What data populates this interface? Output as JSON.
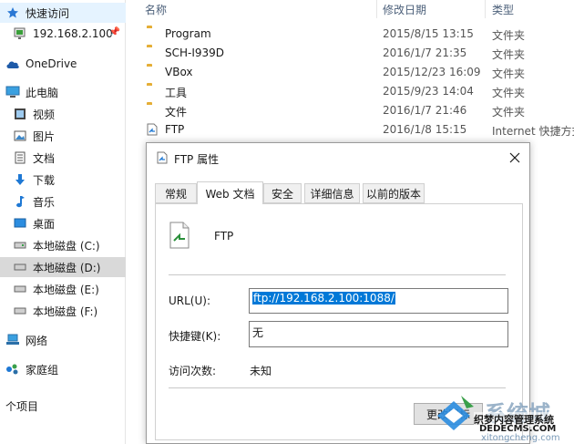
{
  "nav": {
    "items": [
      {
        "label": "快速访问",
        "icon": "star-icon"
      },
      {
        "label": "192.168.2.100",
        "icon": "network-location-icon",
        "pinned": true
      },
      {
        "label": "OneDrive",
        "icon": "cloud-icon"
      },
      {
        "label": "此电脑",
        "icon": "computer-icon"
      },
      {
        "label": "视频",
        "icon": "video-icon"
      },
      {
        "label": "图片",
        "icon": "pictures-icon"
      },
      {
        "label": "文档",
        "icon": "documents-icon"
      },
      {
        "label": "下载",
        "icon": "download-icon"
      },
      {
        "label": "音乐",
        "icon": "music-icon"
      },
      {
        "label": "桌面",
        "icon": "desktop-icon"
      },
      {
        "label": "本地磁盘 (C:)",
        "icon": "drive-icon"
      },
      {
        "label": "本地磁盘 (D:)",
        "icon": "drive-icon",
        "selected": true
      },
      {
        "label": "本地磁盘 (E:)",
        "icon": "drive-icon"
      },
      {
        "label": "本地磁盘 (F:)",
        "icon": "drive-icon"
      },
      {
        "label": "网络",
        "icon": "network-icon"
      },
      {
        "label": "家庭组",
        "icon": "homegroup-icon"
      }
    ],
    "footer": "个项目"
  },
  "list": {
    "headers": {
      "name": "名称",
      "date": "修改日期",
      "type": "类型"
    },
    "rows": [
      {
        "name": "Program",
        "date": "2015/8/15 13:15",
        "type": "文件夹",
        "icon": "folder-icon"
      },
      {
        "name": "SCH-I939D",
        "date": "2016/1/7 21:35",
        "type": "文件夹",
        "icon": "folder-icon"
      },
      {
        "name": "VBox",
        "date": "2015/12/23 16:09",
        "type": "文件夹",
        "icon": "folder-icon"
      },
      {
        "name": "工具",
        "date": "2015/9/23 14:04",
        "type": "文件夹",
        "icon": "folder-icon"
      },
      {
        "name": "文件",
        "date": "2016/1/7 21:46",
        "type": "文件夹",
        "icon": "folder-icon"
      },
      {
        "name": "FTP",
        "date": "2016/1/8 15:15",
        "type": "Internet 快捷方式",
        "icon": "internet-shortcut-icon"
      }
    ]
  },
  "dialog": {
    "title": "FTP 属性",
    "tabs": [
      "常规",
      "Web 文档",
      "安全",
      "详细信息",
      "以前的版本"
    ],
    "active_tab": 1,
    "file_name": "FTP",
    "url_label": "URL(U):",
    "url_value": "ftp://192.168.2.100:1088/",
    "hotkey_label": "快捷键(K):",
    "hotkey_value": "无",
    "visits_label": "访问次数:",
    "visits_value": "未知",
    "button_label": "更改图标"
  },
  "watermark": {
    "main": "系统城",
    "line1": "织梦内容管理系统",
    "line2": "DEDECMS.COM",
    "line3": "xitongcheng.com"
  },
  "colors": {
    "accent": "#0078d7",
    "selection": "#d9d9d9",
    "folder": "#f5c350"
  }
}
